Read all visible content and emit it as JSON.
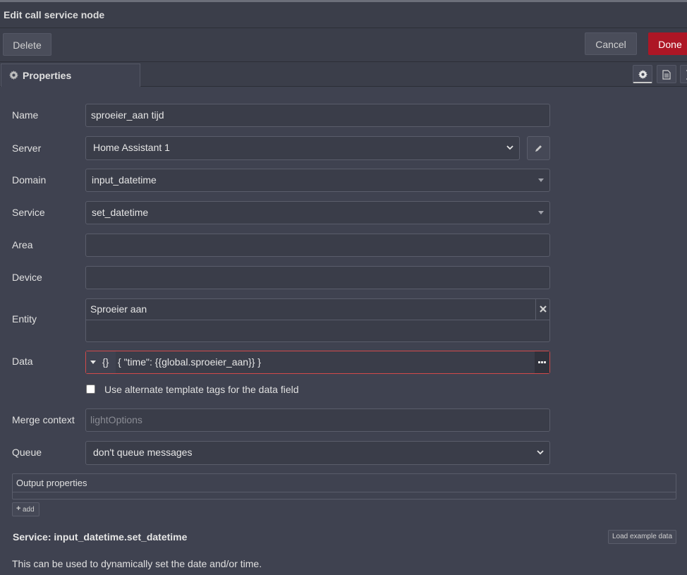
{
  "dialog": {
    "title": "Edit call service node"
  },
  "toolbar": {
    "delete_label": "Delete",
    "cancel_label": "Cancel",
    "done_label": "Done",
    "done_color": "#ad1625"
  },
  "tabs": {
    "properties_label": "Properties",
    "icons": [
      "gear-icon",
      "document-icon",
      "frame-icon"
    ]
  },
  "form": {
    "name": {
      "label": "Name",
      "value": "sproeier_aan tijd"
    },
    "server": {
      "label": "Server",
      "value": "Home Assistant 1"
    },
    "domain": {
      "label": "Domain",
      "value": "input_datetime"
    },
    "service": {
      "label": "Service",
      "value": "set_datetime"
    },
    "area": {
      "label": "Area",
      "value": ""
    },
    "device": {
      "label": "Device",
      "value": ""
    },
    "entity": {
      "label": "Entity",
      "value": "Sproeier aan"
    },
    "data": {
      "label": "Data",
      "type_label": "{}",
      "value": "{ \"time\": {{global.sproeier_aan}} }",
      "error_color": "#d24a4a"
    },
    "alt_tags": {
      "label": "Use alternate template tags for the data field",
      "checked": false
    },
    "merge_context": {
      "label": "Merge context",
      "placeholder": "lightOptions"
    },
    "queue": {
      "label": "Queue",
      "value": "don't queue messages"
    }
  },
  "output": {
    "header": "Output properties",
    "add_label": "add"
  },
  "service_info": {
    "title": "Service: input_datetime.set_datetime",
    "load_example_label": "Load example data",
    "description": "This can be used to dynamically set the date and/or time."
  }
}
